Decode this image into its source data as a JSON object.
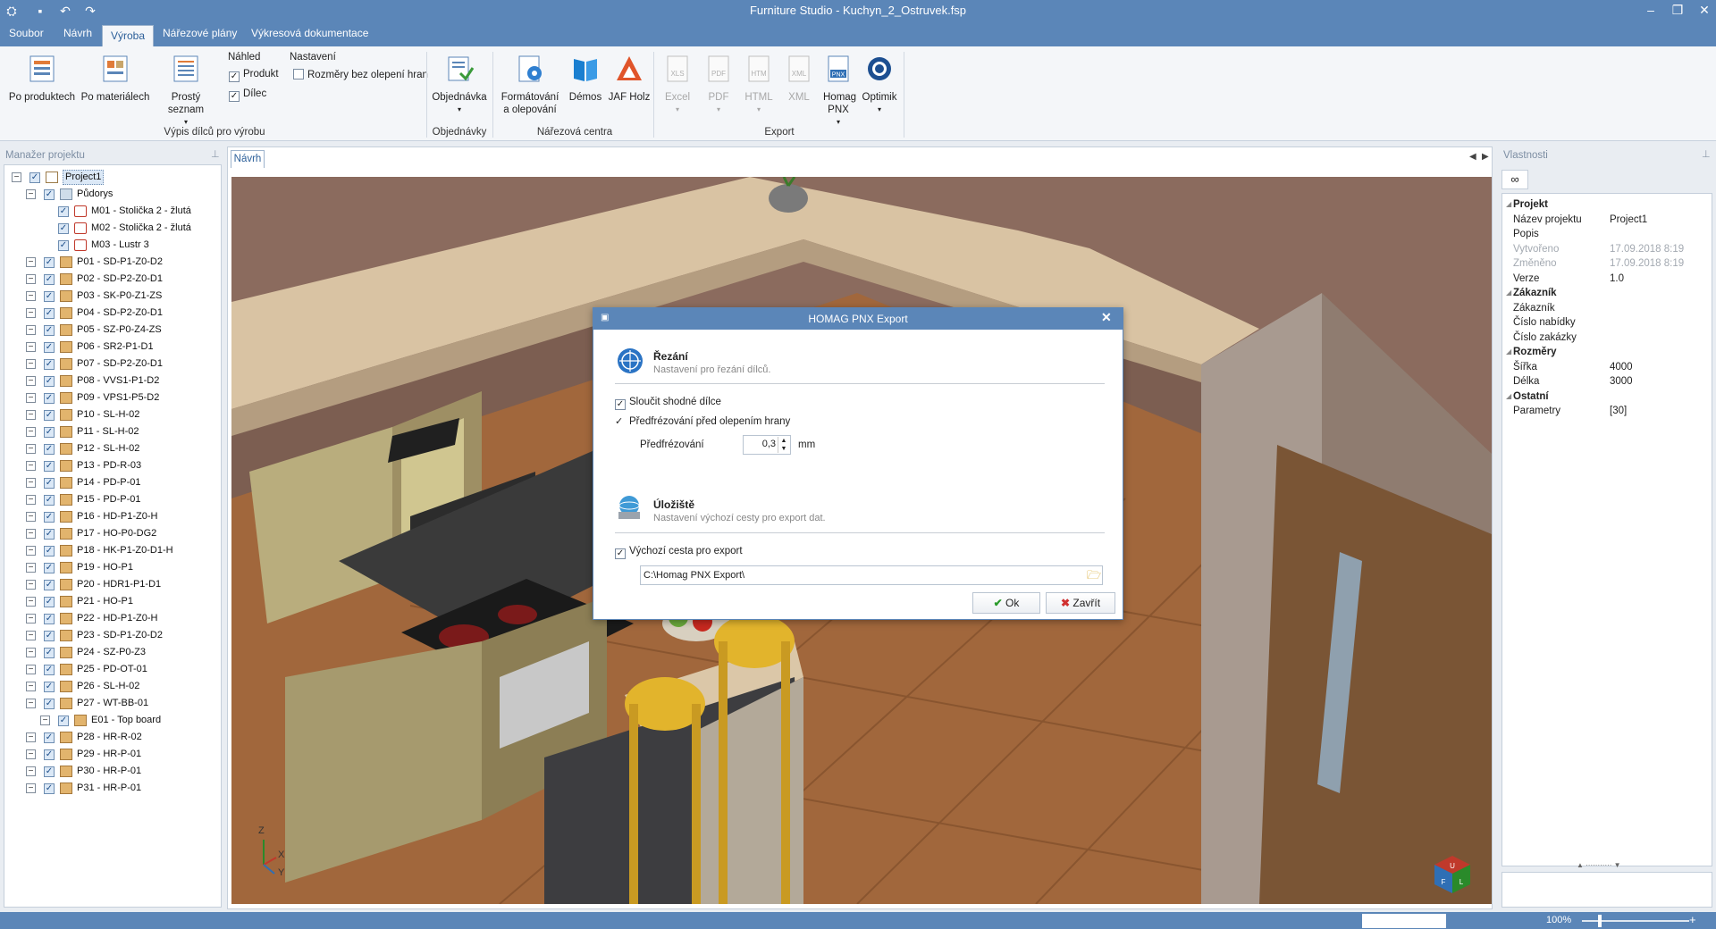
{
  "window": {
    "title": "Furniture Studio - Kuchyn_2_Ostruvek.fsp"
  },
  "menu": {
    "tabs": [
      "Soubor",
      "Návrh",
      "Výroba",
      "Nářezové plány",
      "Výkresová dokumentace"
    ],
    "active": "Výroba"
  },
  "ribbon": {
    "vypis": {
      "po_produktech": "Po produktech",
      "po_materialech": "Po materiálech",
      "prosty_seznam": "Prostý seznam",
      "group": "Výpis dílců pro výrobu"
    },
    "nahled": {
      "label": "Náhled",
      "produkt": "Produkt",
      "dilec": "Dílec"
    },
    "nastaveni": {
      "label": "Nastavení",
      "rozmery": "Rozměry bez olepení hran"
    },
    "objednavky": {
      "objednavka": "Objednávka",
      "group": "Objednávky"
    },
    "narezova": {
      "formatovani": "Formátování a olepování",
      "demos": "Démos",
      "jaf": "JAF Holz",
      "group": "Nářezová centra"
    },
    "export": {
      "excel": "Excel",
      "pdf": "PDF",
      "html": "HTML",
      "xml": "XML",
      "homag": "Homag PNX",
      "optimik": "Optimik",
      "group": "Export"
    },
    "icon_labels": {
      "xls": "XLS",
      "pdf": "PDF",
      "htm": "HTM",
      "xml": "XML",
      "pnx": "PNX"
    }
  },
  "left_panel": {
    "title": "Manažer projektu",
    "tree": [
      {
        "label": "Project1",
        "level": 0,
        "icon": "project"
      },
      {
        "label": "Půdorys",
        "level": 1,
        "icon": "floorplan"
      },
      {
        "label": "M01 - Stolička 2 - žlutá",
        "level": 2,
        "icon": "model"
      },
      {
        "label": "M02 - Stolička 2 - žlutá",
        "level": 2,
        "icon": "model"
      },
      {
        "label": "M03 - Lustr 3",
        "level": 2,
        "icon": "model"
      },
      {
        "label": "P01 - SD-P1-Z0-D2",
        "level": 1,
        "icon": "panel"
      },
      {
        "label": "P02 - SD-P2-Z0-D1",
        "level": 1,
        "icon": "panel"
      },
      {
        "label": "P03 - SK-P0-Z1-ZS",
        "level": 1,
        "icon": "panel"
      },
      {
        "label": "P04 - SD-P2-Z0-D1",
        "level": 1,
        "icon": "panel"
      },
      {
        "label": "P05 - SZ-P0-Z4-ZS",
        "level": 1,
        "icon": "panel"
      },
      {
        "label": "P06 - SR2-P1-D1",
        "level": 1,
        "icon": "panel"
      },
      {
        "label": "P07 - SD-P2-Z0-D1",
        "level": 1,
        "icon": "panel"
      },
      {
        "label": "P08 - VVS1-P1-D2",
        "level": 1,
        "icon": "panel"
      },
      {
        "label": "P09 - VPS1-P5-D2",
        "level": 1,
        "icon": "panel"
      },
      {
        "label": "P10 - SL-H-02",
        "level": 1,
        "icon": "panel"
      },
      {
        "label": "P11 - SL-H-02",
        "level": 1,
        "icon": "panel"
      },
      {
        "label": "P12 - SL-H-02",
        "level": 1,
        "icon": "panel"
      },
      {
        "label": "P13 - PD-R-03",
        "level": 1,
        "icon": "panel"
      },
      {
        "label": "P14 - PD-P-01",
        "level": 1,
        "icon": "panel"
      },
      {
        "label": "P15 - PD-P-01",
        "level": 1,
        "icon": "panel"
      },
      {
        "label": "P16 - HD-P1-Z0-H",
        "level": 1,
        "icon": "panel"
      },
      {
        "label": "P17 - HO-P0-DG2",
        "level": 1,
        "icon": "panel"
      },
      {
        "label": "P18 - HK-P1-Z0-D1-H",
        "level": 1,
        "icon": "panel"
      },
      {
        "label": "P19 - HO-P1",
        "level": 1,
        "icon": "panel"
      },
      {
        "label": "P20 - HDR1-P1-D1",
        "level": 1,
        "icon": "panel"
      },
      {
        "label": "P21 - HO-P1",
        "level": 1,
        "icon": "panel"
      },
      {
        "label": "P22 - HD-P1-Z0-H",
        "level": 1,
        "icon": "panel"
      },
      {
        "label": "P23 - SD-P1-Z0-D2",
        "level": 1,
        "icon": "panel"
      },
      {
        "label": "P24 - SZ-P0-Z3",
        "level": 1,
        "icon": "panel"
      },
      {
        "label": "P25 - PD-OT-01",
        "level": 1,
        "icon": "panel"
      },
      {
        "label": "P26 - SL-H-02",
        "level": 1,
        "icon": "panel"
      },
      {
        "label": "P27 - WT-BB-01",
        "level": 1,
        "icon": "panel"
      },
      {
        "label": "E01 - Top board",
        "level": 2,
        "icon": "panel"
      },
      {
        "label": "P28 - HR-R-02",
        "level": 1,
        "icon": "panel"
      },
      {
        "label": "P29 - HR-P-01",
        "level": 1,
        "icon": "panel"
      },
      {
        "label": "P30 - HR-P-01",
        "level": 1,
        "icon": "panel"
      },
      {
        "label": "P31 - HR-P-01",
        "level": 1,
        "icon": "panel"
      }
    ]
  },
  "viewport": {
    "tab": "Návrh",
    "axes": {
      "z": "Z",
      "x": "X",
      "y": "Y"
    },
    "cube": {
      "u": "U",
      "f": "F",
      "l": "L"
    }
  },
  "right_panel": {
    "title": "Vlastnosti",
    "rows": [
      {
        "k": "Projekt",
        "v": "",
        "section": true
      },
      {
        "k": "Název projektu",
        "v": "Project1"
      },
      {
        "k": "Popis",
        "v": ""
      },
      {
        "k": "Vytvořeno",
        "v": "17.09.2018 8:19",
        "muted": true
      },
      {
        "k": "Změněno",
        "v": "17.09.2018 8:19",
        "muted": true
      },
      {
        "k": "Verze",
        "v": "1.0"
      },
      {
        "k": "Zákazník",
        "v": "",
        "section": true
      },
      {
        "k": "Zákazník",
        "v": ""
      },
      {
        "k": "Číslo nabídky",
        "v": ""
      },
      {
        "k": "Číslo zakázky",
        "v": ""
      },
      {
        "k": "Rozměry",
        "v": "",
        "section": true
      },
      {
        "k": "Šířka",
        "v": "4000"
      },
      {
        "k": "Délka",
        "v": "3000"
      },
      {
        "k": "Ostatní",
        "v": "",
        "section": true
      },
      {
        "k": "Parametry",
        "v": "[30]"
      }
    ]
  },
  "dialog": {
    "title": "HOMAG PNX Export",
    "section1": {
      "title": "Řezání",
      "subtitle": "Nastavení pro řezání dílců."
    },
    "merge_label": "Sloučit shodné dílce",
    "premill_label": "Předfrézování před olepením hrany",
    "premill_field_label": "Předfrézování",
    "premill_value": "0,3",
    "premill_unit": "mm",
    "section2": {
      "title": "Úložiště",
      "subtitle": "Nastavení výchozí cesty pro export dat."
    },
    "default_path_label": "Výchozí cesta pro export",
    "path_value": "C:\\Homag PNX Export\\",
    "ok": "Ok",
    "cancel": "Zavřít"
  },
  "status": {
    "zoom": "100%"
  },
  "colors": {
    "accent": "#5b86b8",
    "wall": "#8a6a5a",
    "floor": "#a0643a"
  }
}
